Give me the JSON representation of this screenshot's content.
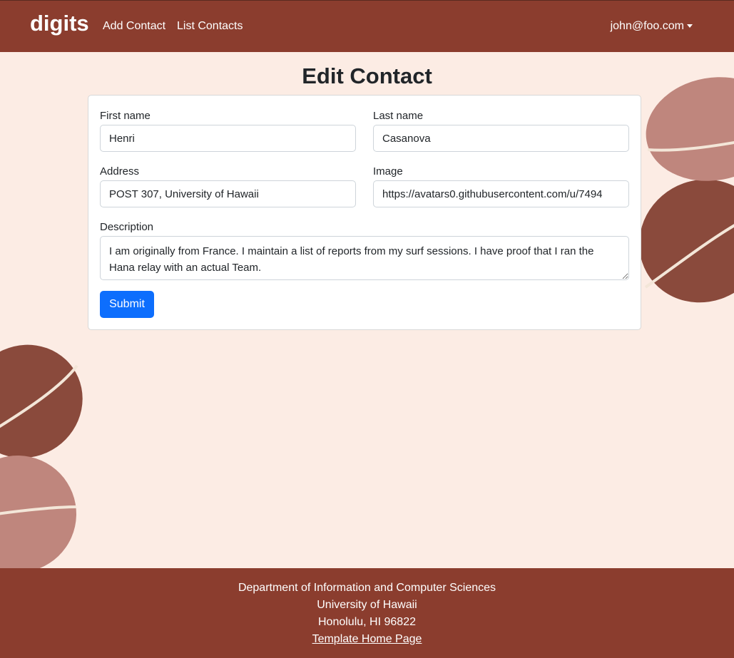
{
  "navbar": {
    "brand": "digits",
    "links": [
      {
        "label": "Add Contact"
      },
      {
        "label": "List Contacts"
      }
    ],
    "user": "john@foo.com"
  },
  "page": {
    "title": "Edit Contact"
  },
  "form": {
    "first_name": {
      "label": "First name",
      "value": "Henri"
    },
    "last_name": {
      "label": "Last name",
      "value": "Casanova"
    },
    "address": {
      "label": "Address",
      "value": "POST 307, University of Hawaii"
    },
    "image": {
      "label": "Image",
      "value": "https://avatars0.githubusercontent.com/u/7494"
    },
    "description": {
      "label": "Description",
      "value": "I am originally from France. I maintain a list of reports from my surf sessions. I have proof that I ran the Hana relay with an actual Team."
    },
    "submit_label": "Submit"
  },
  "footer": {
    "line1": "Department of Information and Computer Sciences",
    "line2": "University of Hawaii",
    "line3": "Honolulu, HI 96822",
    "link": "Template Home Page"
  },
  "colors": {
    "nav_bg": "#8b3d2e",
    "page_bg": "#fcece4",
    "button": "#0d6efd",
    "bean_light": "#bf867d",
    "bean_dark": "#8a4a3c"
  }
}
